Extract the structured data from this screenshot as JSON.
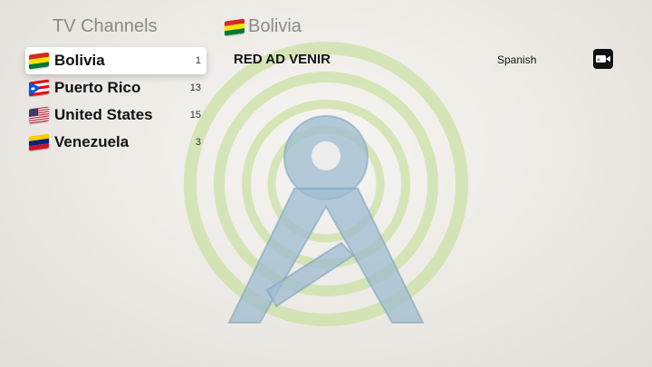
{
  "header": {
    "left_title": "TV Channels",
    "right_title": "Bolivia"
  },
  "countries": [
    {
      "name": "Bolivia",
      "count": "1",
      "selected": true
    },
    {
      "name": "Puerto Rico",
      "count": "13",
      "selected": false
    },
    {
      "name": "United States",
      "count": "15",
      "selected": false
    },
    {
      "name": "Venezuela",
      "count": "3",
      "selected": false
    }
  ],
  "channels": [
    {
      "name": "RED AD VENIR",
      "language": "Spanish",
      "icon": "video-camera-icon"
    }
  ],
  "colors": {
    "ring": "#b7d79b",
    "tower": "#8fb3c9"
  }
}
